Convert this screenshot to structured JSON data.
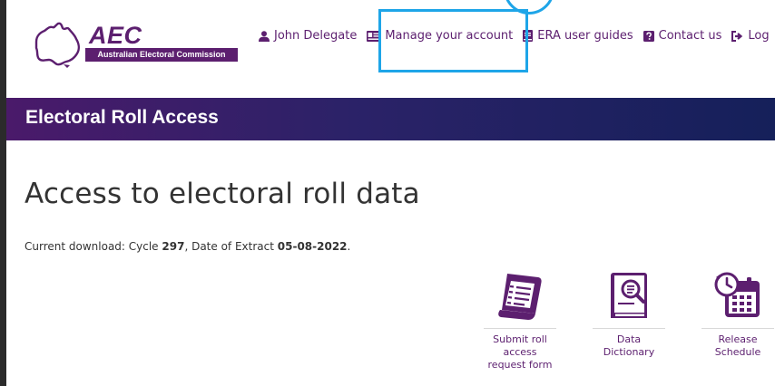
{
  "header": {
    "logo": {
      "acronym": "AEC",
      "full_name": "Australian Electoral Commission"
    },
    "nav": [
      {
        "id": "user",
        "label": "John Delegate",
        "icon": "user-icon"
      },
      {
        "id": "account",
        "label": "Manage your account",
        "icon": "id-card-icon"
      },
      {
        "id": "guides",
        "label": "ERA user guides",
        "icon": "book-icon"
      },
      {
        "id": "contact",
        "label": "Contact us",
        "icon": "question-icon"
      },
      {
        "id": "logout",
        "label": "Log",
        "icon": "sign-out-icon"
      }
    ]
  },
  "banner": {
    "title": "Electoral Roll Access"
  },
  "main": {
    "title": "Access to electoral roll data",
    "download": {
      "prefix": "Current download: Cycle ",
      "cycle": "297",
      "middle": ", Date of Extract ",
      "date": "05-08-2022",
      "suffix": "."
    },
    "tiles": [
      {
        "label": "Submit roll access request form",
        "icon": "form-icon"
      },
      {
        "label": "Data Dictionary",
        "icon": "dictionary-icon"
      },
      {
        "label": "Release Schedule",
        "icon": "calendar-icon"
      }
    ]
  },
  "colors": {
    "brand_purple": "#5c1f6f",
    "highlight": "#1ea5e8",
    "banner_dark": "#15205a"
  }
}
